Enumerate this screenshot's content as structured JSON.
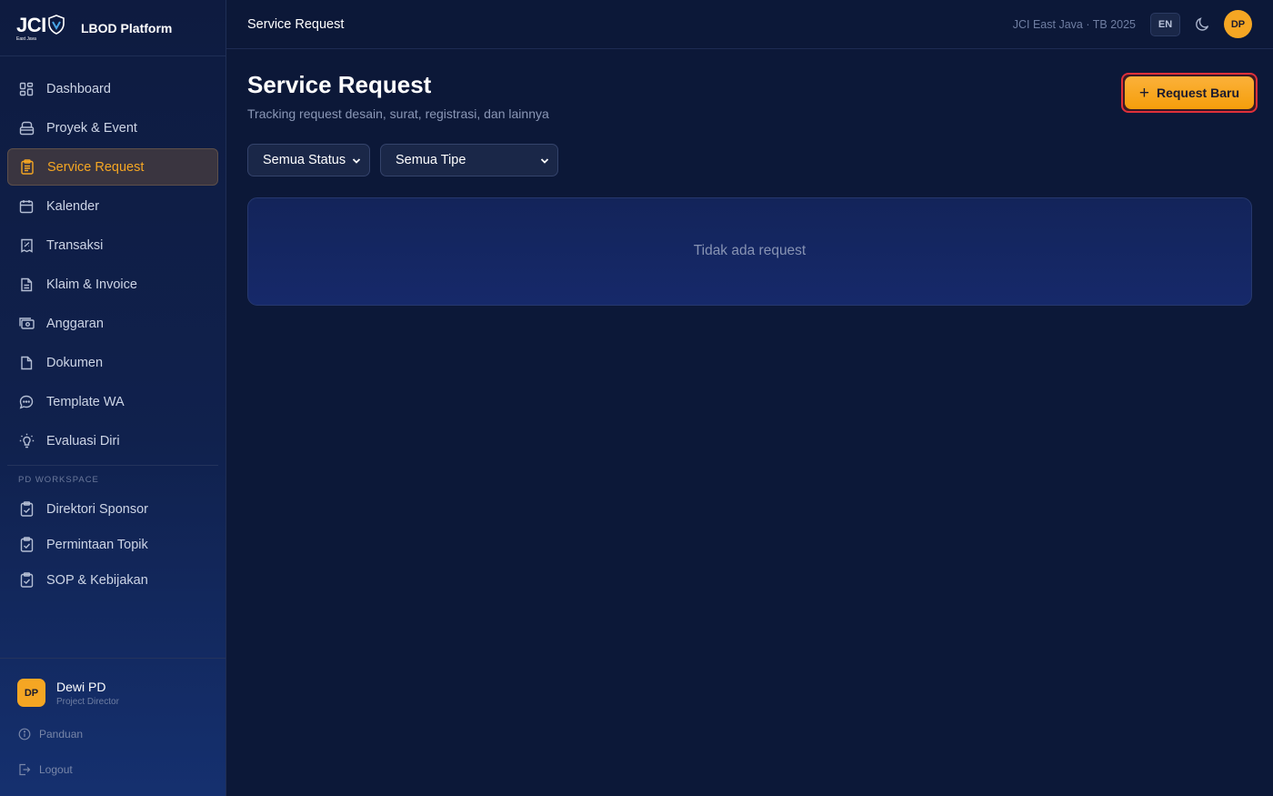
{
  "brand": {
    "logo_text": "JCI",
    "logo_sub": "East Java",
    "name": "LBOD Platform"
  },
  "sidebar": {
    "items": [
      {
        "label": "Dashboard",
        "icon": "grid-icon"
      },
      {
        "label": "Proyek & Event",
        "icon": "briefcase-icon"
      },
      {
        "label": "Service Request",
        "icon": "clipboard-list-icon",
        "active": true
      },
      {
        "label": "Kalender",
        "icon": "calendar-icon"
      },
      {
        "label": "Transaksi",
        "icon": "receipt-icon"
      },
      {
        "label": "Klaim & Invoice",
        "icon": "document-icon"
      },
      {
        "label": "Anggaran",
        "icon": "wallet-icon"
      },
      {
        "label": "Dokumen",
        "icon": "file-icon"
      },
      {
        "label": "Template WA",
        "icon": "chat-icon"
      },
      {
        "label": "Evaluasi Diri",
        "icon": "lightbulb-icon"
      }
    ],
    "section_label": "PD WORKSPACE",
    "workspace_items": [
      {
        "label": "Direktori Sponsor",
        "icon": "clipboard-check-icon"
      },
      {
        "label": "Permintaan Topik",
        "icon": "clipboard-check-icon"
      },
      {
        "label": "SOP & Kebijakan",
        "icon": "clipboard-check-icon"
      }
    ],
    "user": {
      "initials": "DP",
      "name": "Dewi PD",
      "role": "Project Director"
    },
    "help_label": "Panduan",
    "logout_label": "Logout"
  },
  "topbar": {
    "title": "Service Request",
    "org_label": "JCI East Java · TB 2025",
    "lang": "EN",
    "avatar_initials": "DP"
  },
  "main": {
    "title": "Service Request",
    "subtitle": "Tracking request desain, surat, registrasi, dan lainnya",
    "new_button_label": "Request Baru",
    "filters": {
      "status_selected": "Semua Status",
      "type_selected": "Semua Tipe"
    },
    "empty_message": "Tidak ada request"
  },
  "colors": {
    "accent": "#f5a623",
    "background": "#0c1838",
    "highlight_border": "#e0303a"
  }
}
